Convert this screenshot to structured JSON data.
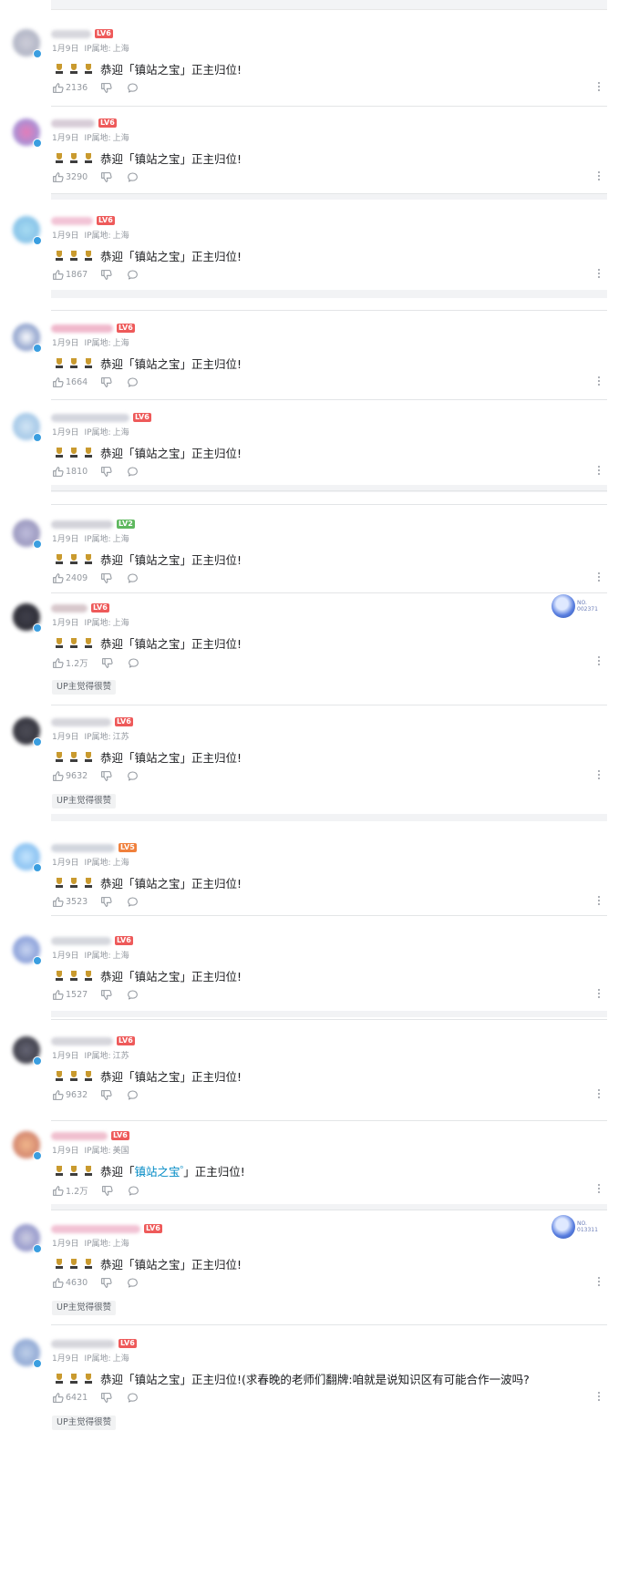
{
  "comment_text": "恭迎「镇站之宝」正主归位!",
  "comment_prefix": "恭迎「",
  "comment_link": "镇站之宝",
  "comment_link_suffix": "」正主归位!",
  "up_badge_label": "UP主觉得很赞",
  "ip_prefix": "IP属地:",
  "colors": {
    "level6": "#ee5a5a",
    "level5": "#f0803c",
    "level2": "#5fb85f",
    "link": "#008ac5"
  },
  "icons": [
    "like-icon",
    "dislike-icon",
    "reply-icon",
    "more-icon",
    "trophy-icon"
  ],
  "comments": [
    {
      "date": "1月9日",
      "ip": "上海",
      "level": "LV6",
      "likes": "2136",
      "text": "恭迎「镇站之宝」正主归位!",
      "up_liked": false
    },
    {
      "date": "1月9日",
      "ip": "上海",
      "level": "LV6",
      "likes": "3290",
      "text": "恭迎「镇站之宝」正主归位!",
      "up_liked": false
    },
    {
      "date": "1月9日",
      "ip": "上海",
      "level": "LV6",
      "likes": "1867",
      "text": "恭迎「镇站之宝」正主归位!",
      "up_liked": false
    },
    {
      "date": "1月9日",
      "ip": "上海",
      "level": "LV6",
      "likes": "1664",
      "text": "恭迎「镇站之宝」正主归位!",
      "up_liked": false
    },
    {
      "date": "1月9日",
      "ip": "上海",
      "level": "LV6",
      "likes": "1810",
      "text": "恭迎「镇站之宝」正主归位!",
      "up_liked": false
    },
    {
      "date": "1月9日",
      "ip": "上海",
      "level": "LV2",
      "likes": "2409",
      "text": "恭迎「镇站之宝」正主归位!",
      "up_liked": false
    },
    {
      "date": "1月9日",
      "ip": "上海",
      "level": "LV6",
      "likes": "1.2万",
      "text": "恭迎「镇站之宝」正主归位!",
      "up_liked": true,
      "garb_no": "NO.",
      "garb_num": "002371"
    },
    {
      "date": "1月9日",
      "ip": "江苏",
      "level": "LV6",
      "likes": "9632",
      "text": "恭迎「镇站之宝」正主归位!",
      "up_liked": true
    },
    {
      "date": "1月9日",
      "ip": "上海",
      "level": "LV5",
      "likes": "3523",
      "text": "恭迎「镇站之宝」正主归位!",
      "up_liked": false
    },
    {
      "date": "1月9日",
      "ip": "上海",
      "level": "LV6",
      "likes": "1527",
      "text": "恭迎「镇站之宝」正主归位!",
      "up_liked": false
    },
    {
      "date": "1月9日",
      "ip": "江苏",
      "level": "LV6",
      "likes": "9632",
      "text": "恭迎「镇站之宝」正主归位!",
      "up_liked": false
    },
    {
      "date": "1月9日",
      "ip": "美国",
      "level": "LV6",
      "likes": "1.2万",
      "text": "恭迎「镇站之宝」正主归位!",
      "up_liked": false,
      "linked": true
    },
    {
      "date": "1月9日",
      "ip": "上海",
      "level": "LV6",
      "likes": "4630",
      "text": "恭迎「镇站之宝」正主归位!",
      "up_liked": true,
      "garb_no": "NO.",
      "garb_num": "013311"
    },
    {
      "date": "1月9日",
      "ip": "上海",
      "level": "LV6",
      "likes": "6421",
      "text": "恭迎「镇站之宝」正主归位!(求春晚的老师们翻牌:咱就是说知识区有可能合作一波吗?",
      "up_liked": true
    }
  ]
}
